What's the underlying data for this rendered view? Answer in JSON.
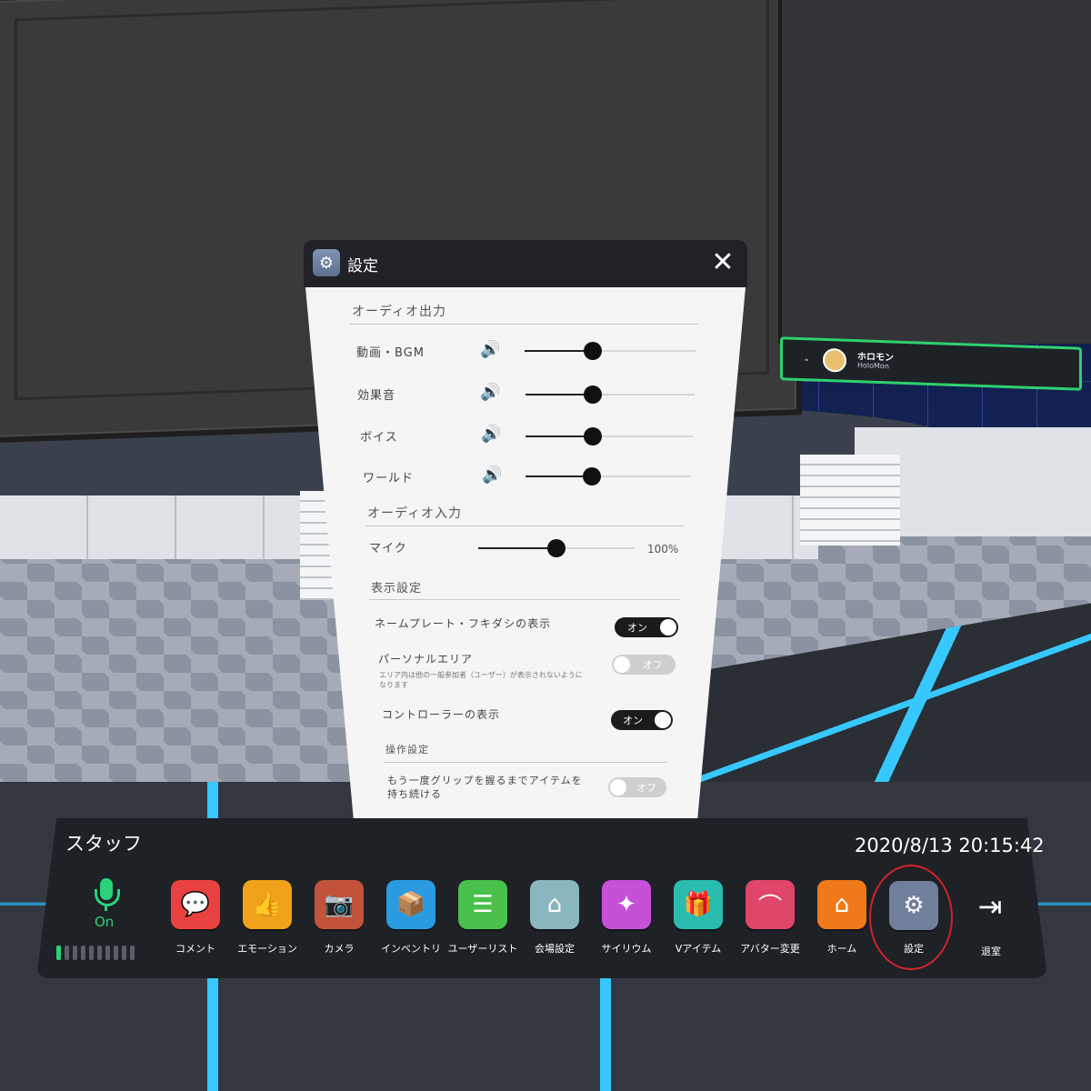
{
  "nameplate": {
    "dash": "-",
    "name": "ホロモン",
    "sub": "HoloMon"
  },
  "settings": {
    "title": "設定",
    "icons": {
      "header": "gear-icon",
      "close": "close-icon",
      "speaker": "speaker-icon"
    },
    "audio_output": {
      "heading": "オーディオ出力",
      "rows": [
        {
          "label": "動画・BGM",
          "level": 0.4
        },
        {
          "label": "効果音",
          "level": 0.4
        },
        {
          "label": "ボイス",
          "level": 0.4
        },
        {
          "label": "ワールド",
          "level": 0.4
        }
      ]
    },
    "audio_input": {
      "heading": "オーディオ入力",
      "mic_label": "マイク",
      "mic_level": 0.5,
      "mic_value": "100%"
    },
    "display": {
      "heading": "表示設定",
      "nameplate_label": "ネームプレート・フキダシの表示",
      "nameplate_toggle": "オン",
      "personal_area_label": "パーソナルエリア",
      "personal_area_desc": "エリア内は他の一般参加者（ユーザー）が表示されないようになります",
      "personal_area_toggle": "オフ",
      "controller_label": "コントローラーの表示",
      "controller_toggle": "オン"
    },
    "operation": {
      "heading": "操作設定",
      "grip_label": "もう一度グリップを握るまでアイテムを持ち続ける",
      "grip_toggle": "オフ"
    }
  },
  "menubar": {
    "role": "スタッフ",
    "datetime": "2020/8/13 20:15:42",
    "mic_status": "On",
    "mic_level_lit": 1,
    "mic_level_total": 10,
    "items": [
      {
        "label": "コメント",
        "icon": "comment-icon",
        "color": "#e8413f"
      },
      {
        "label": "エモーション",
        "icon": "thumbs-up-icon",
        "color": "#f0a21a"
      },
      {
        "label": "カメラ",
        "icon": "camera-icon",
        "color": "#c2533a"
      },
      {
        "label": "インベントリ",
        "icon": "inventory-box-icon",
        "color": "#2a9be0"
      },
      {
        "label": "ユーザーリスト",
        "icon": "user-list-icon",
        "color": "#49c04a"
      },
      {
        "label": "会場設定",
        "icon": "venue-settings-icon",
        "color": "#8ab6c0"
      },
      {
        "label": "サイリウム",
        "icon": "glowstick-icon",
        "color": "#c651d8"
      },
      {
        "label": "Vアイテム",
        "icon": "gift-icon",
        "color": "#2bbcb0"
      },
      {
        "label": "アバター変更",
        "icon": "hanger-icon",
        "color": "#e0466a"
      },
      {
        "label": "ホーム",
        "icon": "home-icon",
        "color": "#f07a1a"
      },
      {
        "label": "設定",
        "icon": "gear-icon",
        "color": "#6f7f9c"
      }
    ],
    "exit_label": "退室",
    "exit_icon": "exit-icon",
    "highlight_color": "#d0232a"
  }
}
